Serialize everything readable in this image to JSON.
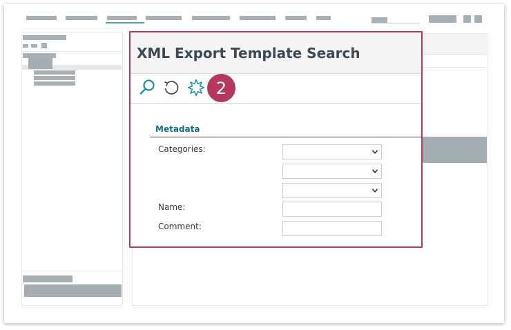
{
  "dialog": {
    "title": "XML Export Template Search",
    "badge_number": "2",
    "toolbar": {
      "search_icon": "search-icon",
      "reset_icon": "reset-icon",
      "clear_icon": "sparkle-icon"
    },
    "section_title": "Metadata",
    "fields": {
      "categories_label": "Categories:",
      "categories_1_value": "",
      "categories_2_value": "",
      "categories_3_value": "",
      "name_label": "Name:",
      "name_value": "",
      "comment_label": "Comment:",
      "comment_value": ""
    }
  },
  "colors": {
    "accent": "#b5395d",
    "section_title": "#177080",
    "title_text": "#3d4a56",
    "placeholder_block": "#a4adb2"
  }
}
